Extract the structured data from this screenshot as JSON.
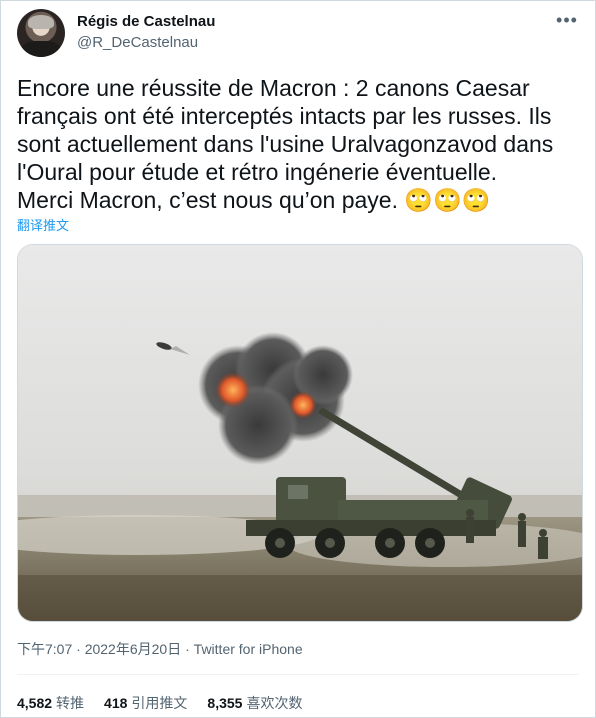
{
  "author": {
    "name": "Régis de Castelnau",
    "handle": "@R_DeCastelnau"
  },
  "tweet": {
    "text": "Encore une réussite de Macron : 2 canons Caesar\nfrançais ont été interceptés intacts par les russes. Ils\nsont actuellement dans l'usine Uralvagonzavod dans\nl'Oural pour étude et rétro ingénerie éventuelle.\nMerci Macron, c’est nous qu’on paye. 🙄🙄🙄",
    "translate_label": "翻译推文"
  },
  "meta": {
    "time": "下午7:07",
    "separator": "·",
    "date": "2022年6月20日",
    "source": "Twitter for iPhone"
  },
  "stats": {
    "retweets_count": "4,582",
    "retweets_label": "转推",
    "quotes_count": "418",
    "quotes_label": "引用推文",
    "likes_count": "8,355",
    "likes_label": "喜欢次数"
  },
  "colors": {
    "accent": "#1d9bf0",
    "secondary_text": "#536471",
    "border": "#cfd9de"
  },
  "icons": {
    "more": "more-horizontal-icon"
  }
}
